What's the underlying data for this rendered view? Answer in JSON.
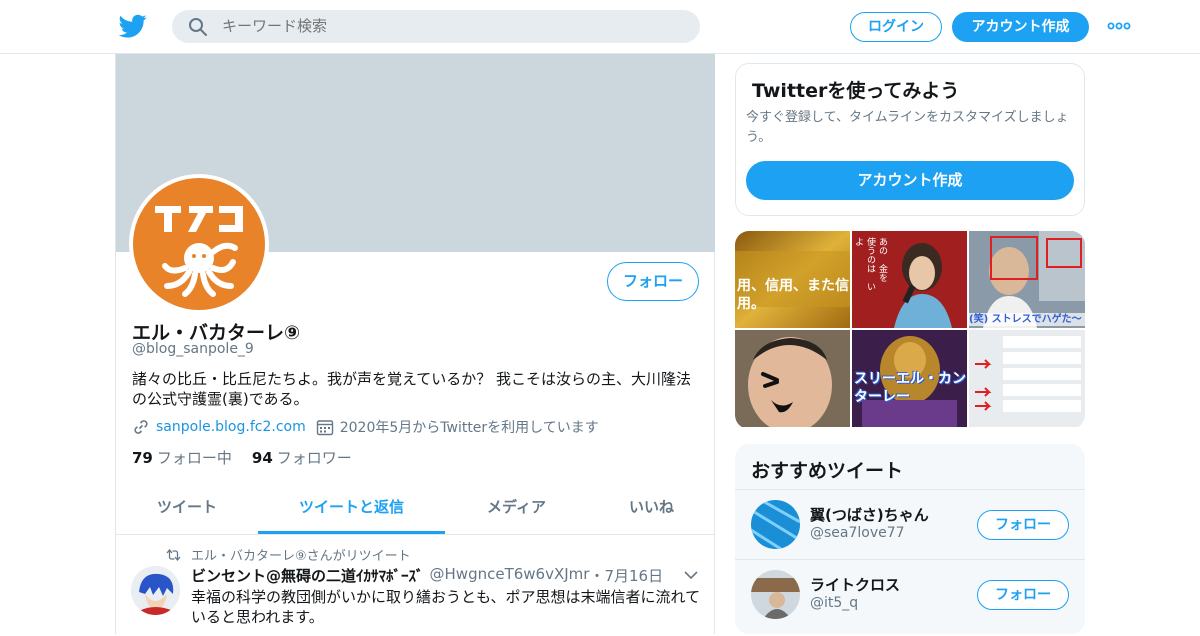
{
  "colors": {
    "brand": "#1da1f2",
    "link": "#1b95e0",
    "avatar_bg": "#e8832a",
    "banner": "#ccd6dd"
  },
  "topbar": {
    "logo_icon": "twitter-bird-icon",
    "search_placeholder": "キーワード検索",
    "login_label": "ログイン",
    "signup_label": "アカウント作成",
    "more_icon": "more-dots-icon"
  },
  "profile": {
    "avatar_text": "TAKO",
    "follow_label": "フォロー",
    "name": "エル・バカターレ⑨",
    "handle": "@blog_sanpole_9",
    "bio": "諸々の比丘・比丘尼たちよ。我が声を覚えているか？ 我こそは汝らの主、大川隆法の公式守護霊(裏)である。",
    "website": "sanpole.blog.fc2.com",
    "joined": "2020年5月からTwitterを利用しています",
    "following_count": "79",
    "following_label": "フォロー中",
    "followers_count": "94",
    "followers_label": "フォロワー"
  },
  "tabs": [
    {
      "label": "ツイート",
      "active": false
    },
    {
      "label": "ツイートと返信",
      "active": true
    },
    {
      "label": "メディア",
      "active": false
    },
    {
      "label": "いいね",
      "active": false
    }
  ],
  "tweet": {
    "retweet_context": "エル・バカターレ⑨さんがリツイート",
    "name": "ビンセント@無碍の二道ｲｶｻﾏﾎﾞｰｽﾞ",
    "handle": "@HwgnceT6w6vXJmr",
    "separator": "・",
    "date": "7月16日",
    "text": "幸福の科学の教団側がいかに取り繕おうとも、ポア思想は末端信者に流れていると思われます。"
  },
  "signup_card": {
    "title": "Twitterを使ってみよう",
    "desc": "今すぐ登録して、タイムラインをカスタマイズしましょう。",
    "button": "アカウント作成"
  },
  "media": {
    "tile1_text": "用、信用、また信用。",
    "tile2_text": "あの　金を　使うのは　いよ",
    "tile3_text": "(笑) ストレスでハゲた～",
    "tile5_text": "スリーエル・カンターレー"
  },
  "recommend": {
    "title": "おすすめツイート",
    "users": [
      {
        "name": "翼(つばさ)ちゃん",
        "handle": "@sea7love77",
        "button": "フォロー"
      },
      {
        "name": "ライトクロス",
        "handle": "@it5_q",
        "button": "フォロー"
      }
    ]
  }
}
